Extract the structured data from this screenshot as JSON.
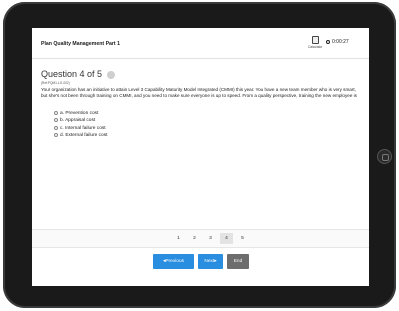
{
  "header": {
    "title": "Plan Quality Management Part 1",
    "calculator_label": "Calculator",
    "timer": "0:00:27"
  },
  "question": {
    "heading": "Question 4 of 5",
    "reference": "(Ref:PQM1-LG-002)",
    "text": "Your organization has an initiative to attain Level 3 Capability Maturity Model Integrated (CMMI) this year. You have a new team member who is very smart, but she's not been through training on CMMI, and you need to make sure everyone is up to speed. From a quality perspective, training the new employee is",
    "options": [
      "a. Prevention cost",
      "b. Appraisal cost",
      "c. Internal failure cost",
      "d. External failure cost"
    ]
  },
  "pagination": {
    "pages": [
      "1",
      "2",
      "3",
      "4",
      "5"
    ],
    "current": "4"
  },
  "nav": {
    "previous": "◂Previous",
    "next": "Next▸",
    "end": "End"
  },
  "icons": {
    "calculator": "calculator-icon",
    "timer": "clock-icon",
    "flag": "flag-icon"
  },
  "colors": {
    "accent": "#2a8ee0",
    "end_button": "#6d6d6d"
  }
}
